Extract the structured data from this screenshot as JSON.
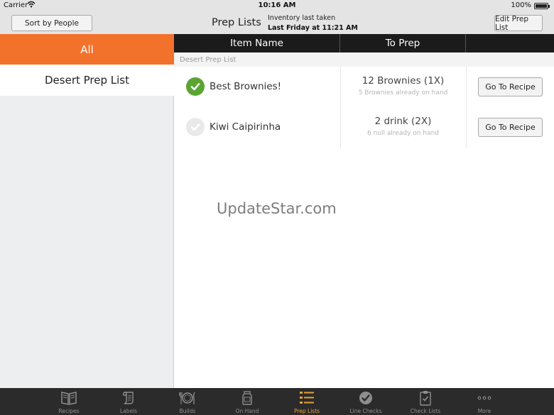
{
  "status_bar": {
    "carrier": "Carrier",
    "time": "10:16 AM",
    "battery_pct": "100%"
  },
  "nav": {
    "sort_button": "Sort by People",
    "title": "Prep Lists",
    "inventory_label": "Inventory last taken",
    "inventory_value": "Last Friday at 11:21 AM",
    "edit_button": "Edit Prep List"
  },
  "sidebar": {
    "all_label": "All",
    "items": [
      {
        "label": "Desert Prep List"
      }
    ]
  },
  "table": {
    "columns": [
      "Item Name",
      "To Prep"
    ],
    "section_title": "Desert Prep List",
    "rows": [
      {
        "name": "Best Brownies!",
        "checked": true,
        "amount": "12 Brownies (1X)",
        "sub": "5 Brownies already on hand",
        "button": "Go To Recipe"
      },
      {
        "name": "Kiwi Caipirinha",
        "checked": false,
        "amount": "2 drink (2X)",
        "sub": "6 null already on hand",
        "button": "Go To Recipe"
      }
    ]
  },
  "watermark": "UpdateStar.com",
  "tabs": [
    {
      "label": "Recipes",
      "icon": "book-icon"
    },
    {
      "label": "Labels",
      "icon": "label-icon"
    },
    {
      "label": "Builds",
      "icon": "plate-cutlery-icon"
    },
    {
      "label": "On Hand",
      "icon": "jar-icon"
    },
    {
      "label": "Prep Lists",
      "icon": "list-icon",
      "active": true
    },
    {
      "label": "Line Checks",
      "icon": "check-circle-icon"
    },
    {
      "label": "Check Lists",
      "icon": "clipboard-check-icon"
    },
    {
      "label": "More",
      "icon": "more-dots-icon"
    }
  ],
  "colors": {
    "accent": "#f2712b",
    "check_green": "#5aa532",
    "tab_active": "#e6a13a",
    "header_dark": "#1b1b1b"
  }
}
